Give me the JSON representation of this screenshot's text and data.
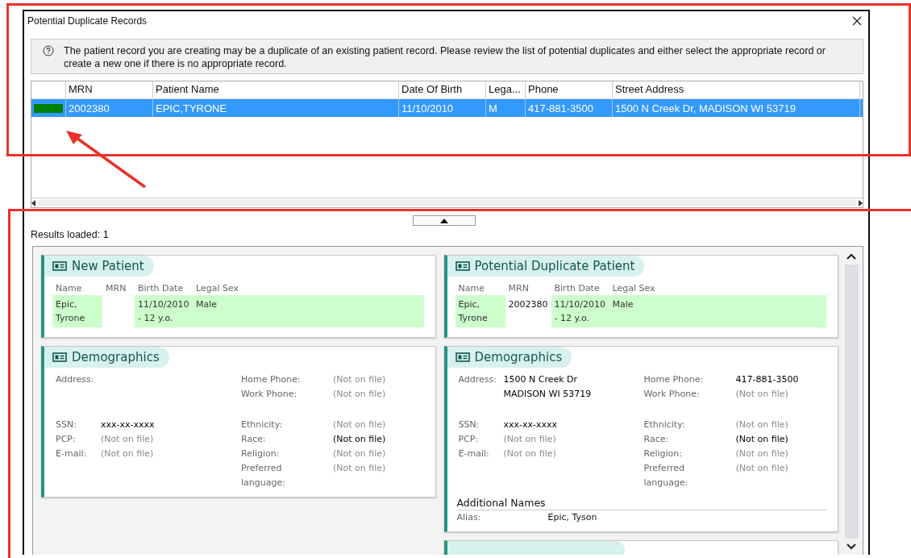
{
  "window": {
    "title": "Potential Duplicate Records"
  },
  "info": {
    "message": "The patient record you are creating may be a duplicate of an existing patient record. Please review the list of potential duplicates and either select the appropriate record or create a new one if there is no appropriate record."
  },
  "grid": {
    "columns": [
      "MRN",
      "Patient Name",
      "Date Of Birth",
      "Lega...",
      "Phone",
      "Street Address"
    ],
    "rows": [
      {
        "selected": true,
        "color": "#008000",
        "cells": [
          "2002380",
          "EPIC,TYRONE",
          "11/10/2010",
          "M",
          "417-881-3500",
          "1500 N Creek Dr, MADISON WI 53719"
        ]
      }
    ]
  },
  "results": "Results loaded: 1",
  "columns": [
    {
      "summary": {
        "title": "New Patient",
        "fields": [
          {
            "label": "Name",
            "value": "Epic, Tyrone",
            "highlighted": true
          },
          {
            "label": "MRN",
            "highlighted": false
          },
          {
            "label": "Birth Date",
            "value": "11/10/2010 - 12 y.o.",
            "highlighted": true
          },
          {
            "label": "Legal Sex",
            "value": "Male",
            "highlighted": true
          }
        ]
      },
      "demographics": {
        "title": "Demographics",
        "left": [
          {
            "label": "Address:"
          },
          {
            "label": "SSN:",
            "lines": [
              "xxx-xx-xxxx"
            ],
            "dim": false
          },
          {
            "label": "PCP:",
            "lines": [
              "(Not on file)"
            ],
            "dim": true
          },
          {
            "label": "E-mail:",
            "lines": [
              "(Not on file)"
            ],
            "dim": true
          }
        ],
        "right": [
          {
            "label": "Home Phone:",
            "value": "(Not on file)",
            "dim": true
          },
          {
            "label": "Work Phone:",
            "value": "(Not on file)",
            "dim": true
          },
          {
            "label": "Ethnicity:",
            "value": "(Not on file)",
            "dim": true
          },
          {
            "label": "Race:",
            "value": "(Not on file)",
            "dim": false
          },
          {
            "label": "Religion:",
            "value": "(Not on file)",
            "dim": true
          },
          {
            "label": "Preferred language:",
            "value": "(Not on file)",
            "dim": true
          }
        ]
      }
    },
    {
      "summary": {
        "title": "Potential Duplicate Patient",
        "fields": [
          {
            "label": "Name",
            "value": "Epic, Tyrone",
            "highlighted": true
          },
          {
            "label": "MRN",
            "value": "2002380",
            "highlighted": false
          },
          {
            "label": "Birth Date",
            "value": "11/10/2010 - 12 y.o.",
            "highlighted": true
          },
          {
            "label": "Legal Sex",
            "value": "Male",
            "highlighted": true
          }
        ]
      },
      "demographics": {
        "title": "Demographics",
        "left": [
          {
            "label": "Address:",
            "lines": [
              "1500 N Creek Dr",
              "MADISON WI 53719"
            ],
            "dim": false
          },
          {
            "label": "SSN:",
            "lines": [
              "xxx-xx-xxxx"
            ],
            "dim": false
          },
          {
            "label": "PCP:",
            "lines": [
              "(Not on file)"
            ],
            "dim": true
          },
          {
            "label": "E-mail:",
            "lines": [
              "(Not on file)"
            ],
            "dim": true
          }
        ],
        "right": [
          {
            "label": "Home Phone:",
            "value": "417-881-3500",
            "dim": false
          },
          {
            "label": "Work Phone:",
            "value": "(Not on file)",
            "dim": true
          },
          {
            "label": "Ethnicity:",
            "value": "(Not on file)",
            "dim": true
          },
          {
            "label": "Race:",
            "value": "(Not on file)",
            "dim": false
          },
          {
            "label": "Religion:",
            "value": "(Not on file)",
            "dim": true
          },
          {
            "label": "Preferred language:",
            "value": "(Not on file)",
            "dim": true
          }
        ],
        "additional": {
          "heading": "Additional Names",
          "rows": [
            {
              "label": "Alias:",
              "value": "Epic, Tyson"
            }
          ]
        }
      },
      "more": true
    }
  ]
}
